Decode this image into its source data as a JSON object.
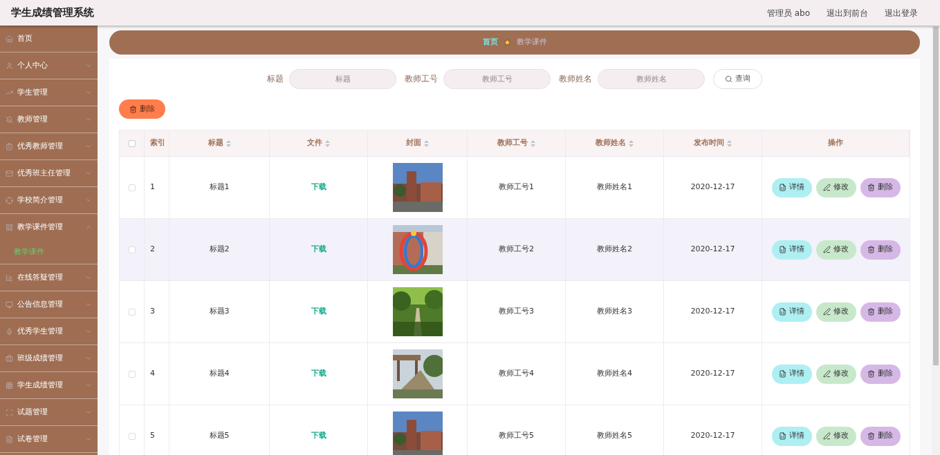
{
  "header": {
    "title": "学生成绩管理系统",
    "user": "管理员 abo",
    "links": [
      "退出到前台",
      "退出登录"
    ]
  },
  "sidebar": {
    "items": [
      {
        "label": "首页",
        "kind": "link"
      },
      {
        "label": "个人中心",
        "kind": "menu",
        "expanded": false
      },
      {
        "label": "学生管理",
        "kind": "menu",
        "expanded": false
      },
      {
        "label": "教师管理",
        "kind": "menu",
        "expanded": false
      },
      {
        "label": "优秀教师管理",
        "kind": "menu",
        "expanded": false
      },
      {
        "label": "优秀班主任管理",
        "kind": "menu",
        "expanded": false
      },
      {
        "label": "学校简介管理",
        "kind": "menu",
        "expanded": false
      },
      {
        "label": "教学课件管理",
        "kind": "menu",
        "expanded": true,
        "children": [
          {
            "label": "教学课件",
            "selected": true
          }
        ]
      },
      {
        "label": "在线答疑管理",
        "kind": "menu",
        "expanded": false
      },
      {
        "label": "公告信息管理",
        "kind": "menu",
        "expanded": false
      },
      {
        "label": "优秀学生管理",
        "kind": "menu",
        "expanded": false
      },
      {
        "label": "班级成绩管理",
        "kind": "menu",
        "expanded": false
      },
      {
        "label": "学生成绩管理",
        "kind": "menu",
        "expanded": false
      },
      {
        "label": "试题管理",
        "kind": "menu",
        "expanded": false
      },
      {
        "label": "试卷管理",
        "kind": "menu",
        "expanded": false
      }
    ]
  },
  "breadcrumb": [
    "首页",
    "教学课件"
  ],
  "search": {
    "fields": [
      {
        "label": "标题",
        "placeholder": "标题"
      },
      {
        "label": "教师工号",
        "placeholder": "教师工号"
      },
      {
        "label": "教师姓名",
        "placeholder": "教师姓名"
      }
    ],
    "button": "查询"
  },
  "delete_button": "删除",
  "table": {
    "select_all_checked": false,
    "columns": [
      {
        "label": "索引",
        "kind": "plain"
      },
      {
        "label": "标题",
        "kind": "sortable"
      },
      {
        "label": "文件",
        "kind": "sortable"
      },
      {
        "label": "封面",
        "kind": "sortable"
      },
      {
        "label": "教师工号",
        "kind": "sortable"
      },
      {
        "label": "教师姓名",
        "kind": "sortable"
      },
      {
        "label": "发布时间",
        "kind": "sortable"
      },
      {
        "label": "操作",
        "kind": "plain"
      }
    ],
    "rows": [
      {
        "index": "1",
        "title": "标题1",
        "file": "下载",
        "teacher_id": "教师工号1",
        "teacher_name": "教师姓名1",
        "date": "2020-12-17",
        "checked": false,
        "highlighted": false,
        "actions": [
          {
            "kind": "detail",
            "label": "详情"
          },
          {
            "kind": "edit",
            "label": "修改"
          },
          {
            "kind": "delete",
            "label": "删除"
          }
        ]
      },
      {
        "index": "2",
        "title": "标题2",
        "file": "下载",
        "teacher_id": "教师工号2",
        "teacher_name": "教师姓名2",
        "date": "2020-12-17",
        "checked": false,
        "highlighted": true,
        "actions": [
          {
            "kind": "detail",
            "label": "详情"
          },
          {
            "kind": "edit",
            "label": "修改"
          },
          {
            "kind": "delete",
            "label": "删除"
          }
        ]
      },
      {
        "index": "3",
        "title": "标题3",
        "file": "下载",
        "teacher_id": "教师工号3",
        "teacher_name": "教师姓名3",
        "date": "2020-12-17",
        "checked": false,
        "highlighted": false,
        "actions": [
          {
            "kind": "detail",
            "label": "详情"
          },
          {
            "kind": "edit",
            "label": "修改"
          },
          {
            "kind": "delete",
            "label": "删除"
          }
        ]
      },
      {
        "index": "4",
        "title": "标题4",
        "file": "下载",
        "teacher_id": "教师工号4",
        "teacher_name": "教师姓名4",
        "date": "2020-12-17",
        "checked": false,
        "highlighted": false,
        "actions": [
          {
            "kind": "detail",
            "label": "详情"
          },
          {
            "kind": "edit",
            "label": "修改"
          },
          {
            "kind": "delete",
            "label": "删除"
          }
        ]
      },
      {
        "index": "5",
        "title": "标题5",
        "file": "下载",
        "teacher_id": "教师工号5",
        "teacher_name": "教师姓名5",
        "date": "2020-12-17",
        "checked": false,
        "highlighted": false,
        "actions": [
          {
            "kind": "detail",
            "label": "详情"
          },
          {
            "kind": "edit",
            "label": "修改"
          },
          {
            "kind": "delete",
            "label": "删除"
          }
        ]
      }
    ]
  }
}
